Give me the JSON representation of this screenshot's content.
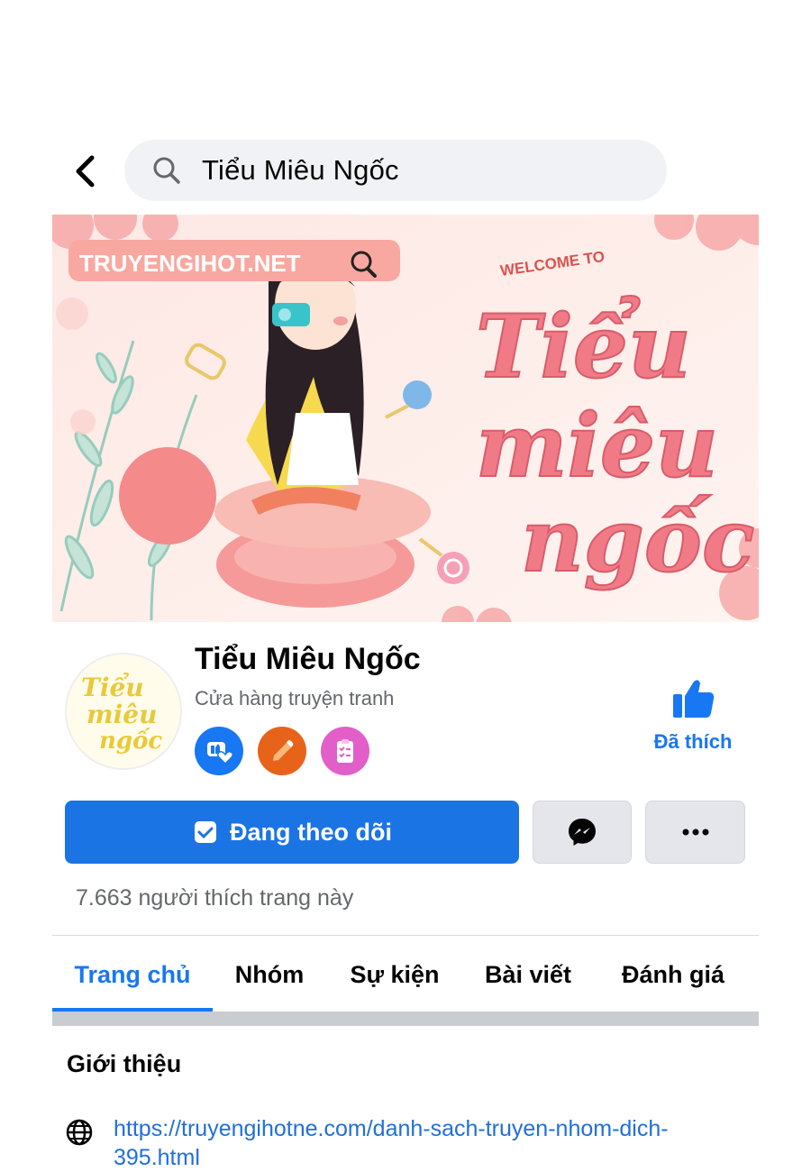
{
  "search": {
    "query": "Tiểu Miêu Ngốc"
  },
  "cover": {
    "watermark": "TRUYENGIHOT.NET",
    "welcome": "WELCOME TO",
    "title_lines": [
      "Tiểu",
      "miêu",
      "ngốc"
    ]
  },
  "profile": {
    "name": "Tiểu Miêu Ngốc",
    "category": "Cửa hàng truyện tranh",
    "avatar_lines": [
      "Tiểu",
      "miêu",
      "ngốc"
    ],
    "badges": [
      {
        "icon": "thumbs-heart-icon",
        "color": "#1877f2"
      },
      {
        "icon": "pencil-icon",
        "color": "#e8631a"
      },
      {
        "icon": "clipboard-icon",
        "color": "#e25fc9"
      }
    ]
  },
  "like_action": {
    "label": "Đã thích",
    "icon": "thumbs-up-icon"
  },
  "actions": {
    "follow_label": "Đang theo dõi",
    "messenger_icon": "messenger-icon",
    "more_icon": "more-icon"
  },
  "likes_text": "7.663 người thích trang này",
  "tabs": [
    {
      "label": "Trang chủ",
      "active": true
    },
    {
      "label": "Nhóm"
    },
    {
      "label": "Sự kiện"
    },
    {
      "label": "Bài viết"
    },
    {
      "label": "Đánh giá"
    }
  ],
  "intro": {
    "title": "Giới thiệu",
    "website": "https://truyengihotne.com/danh-sach-truyen-nhom-dich-395.html"
  },
  "colors": {
    "primary": "#1877f2",
    "follow_button": "#1b74e4",
    "cover_pink": "#f08a94"
  }
}
